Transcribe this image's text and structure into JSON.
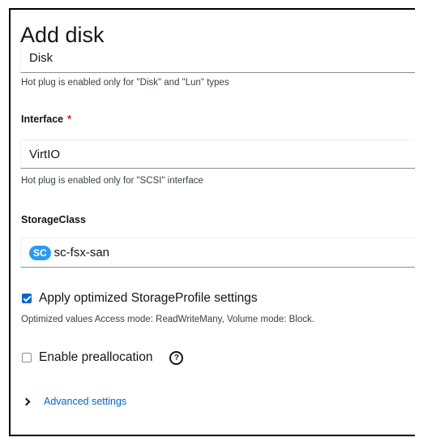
{
  "modal": {
    "title": "Add disk"
  },
  "type_field": {
    "value": "Disk",
    "helper": "Hot plug is enabled only for \"Disk\" and \"Lun\" types"
  },
  "interface_field": {
    "label": "Interface",
    "required_marker": "*",
    "value": "VirtIO",
    "helper": "Hot plug is enabled only for \"SCSI\" interface"
  },
  "storage_class": {
    "label": "StorageClass",
    "badge": "SC",
    "value": "sc-fsx-san"
  },
  "optimized_profile": {
    "checked": true,
    "label": "Apply optimized StorageProfile settings",
    "helper": "Optimized values Access mode: ReadWriteMany, Volume mode: Block."
  },
  "preallocation": {
    "checked": false,
    "label": "Enable preallocation",
    "help_icon": "help-circle-icon",
    "help_glyph": "?"
  },
  "advanced": {
    "label": "Advanced settings",
    "icon": "chevron-right-icon"
  },
  "colors": {
    "link": "#0066cc",
    "checkbox": "#0066cc",
    "badge": "#2b9af3",
    "required": "#c9190b"
  }
}
